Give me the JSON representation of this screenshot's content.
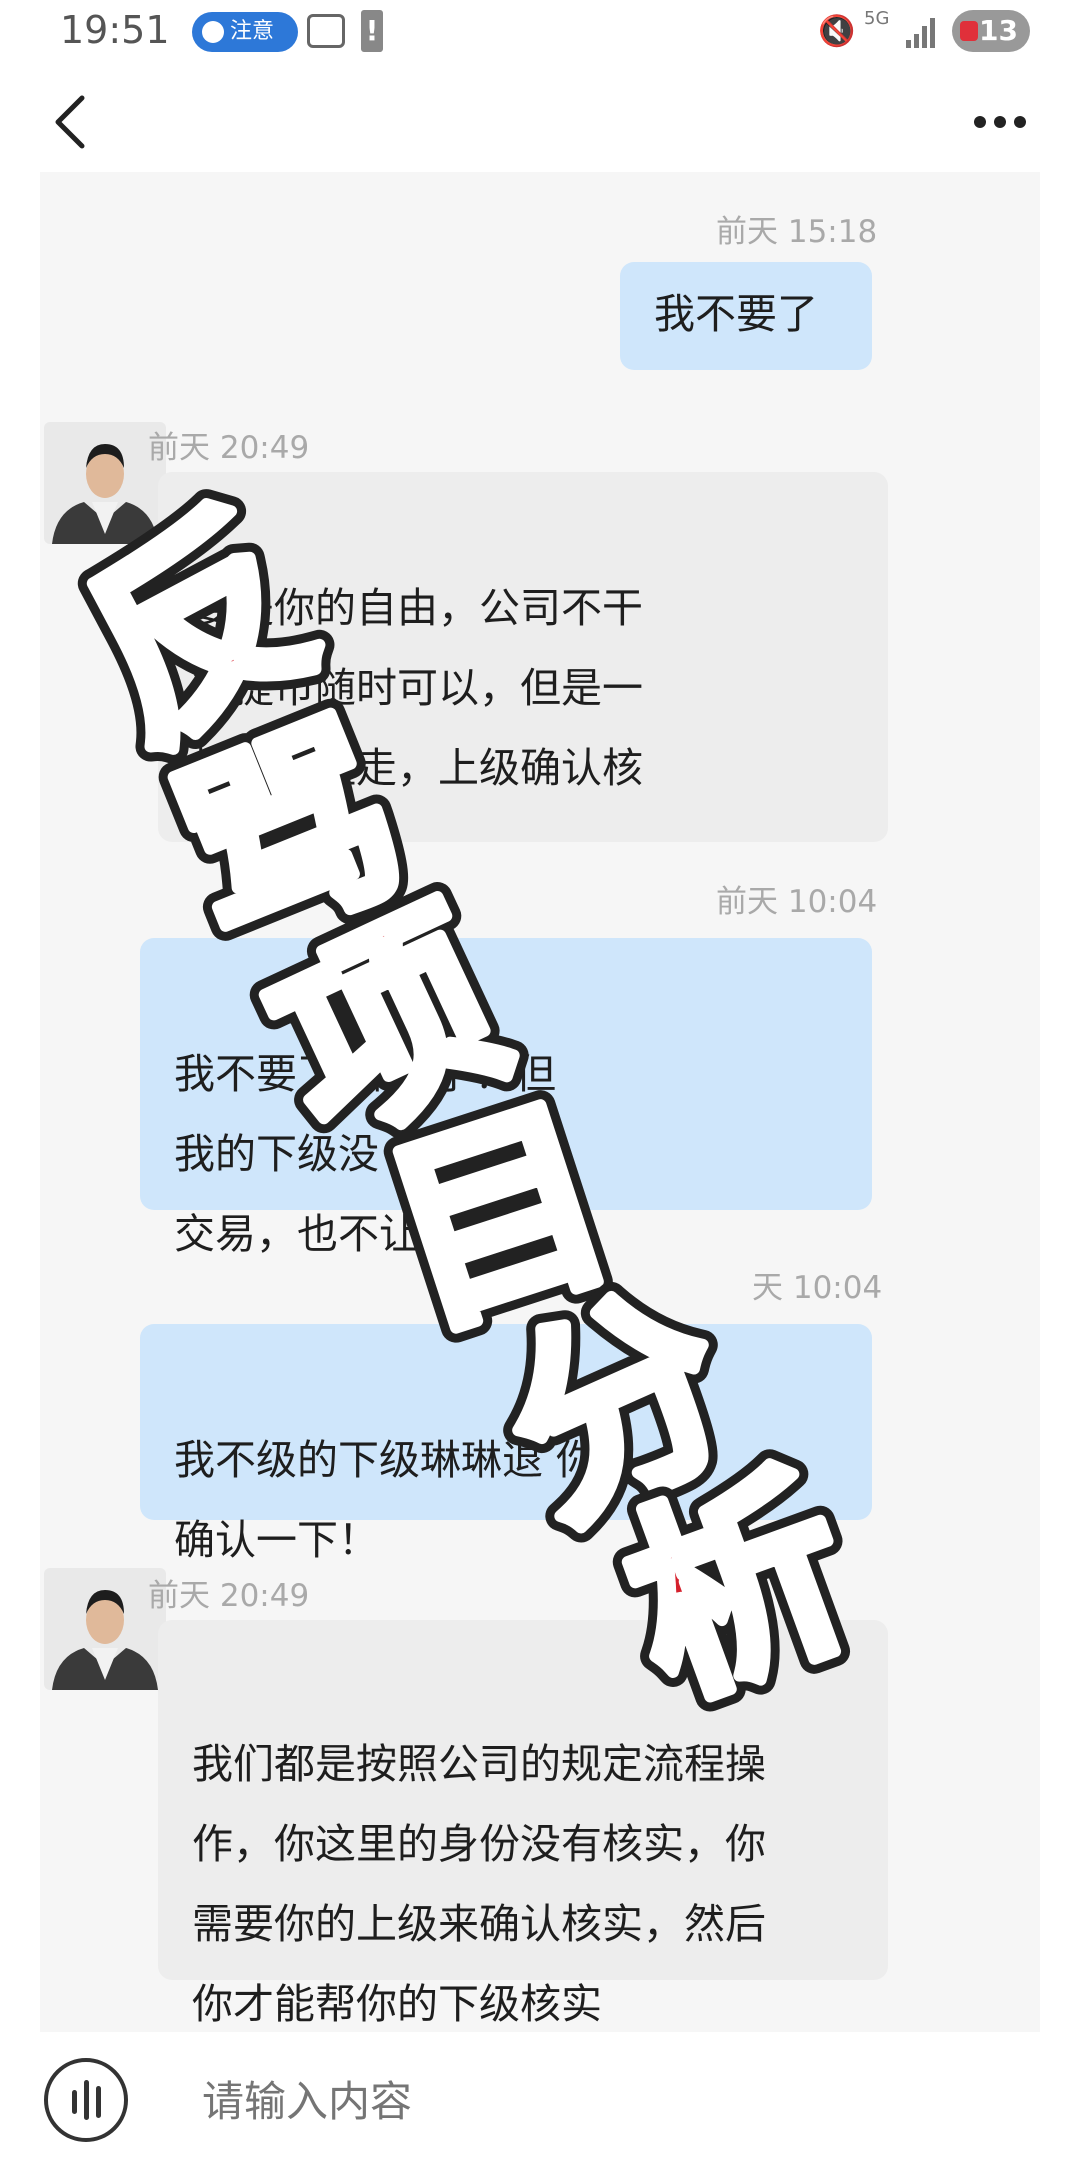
{
  "status_bar": {
    "time": "19:51",
    "pill_label": "注意",
    "network": "5G",
    "battery": "13"
  },
  "icons": {
    "back": "back-icon",
    "more": "more-icon",
    "voice": "voice-icon",
    "mute": "mute-icon",
    "camera": "screenshot-icon",
    "warning": "warning-icon",
    "signal": "signal-icon",
    "battery": "battery-icon"
  },
  "chat": {
    "messages": [
      {
        "side": "out",
        "time": "前天 15:18",
        "text": "我不要了"
      },
      {
        "side": "in",
        "time": "前天 20:49",
        "text": "要是你的自由，公司不干\n想提币随时可以，但是一\n按定流程走，上级确认核"
      },
      {
        "side": "out",
        "time": "前天 10:04",
        "text": "我不要了   操作了！但\n我的下级没   别人正常\n交易，也不让"
      },
      {
        "side": "out",
        "time": "天 10:04",
        "text": "我不级的下级琳琳退        你\n确认一下！"
      },
      {
        "side": "in",
        "time": "前天 20:49",
        "text": "我们都是按照公司的规定流程操\n作，你这里的身份没有核实，你\n需要你的上级来确认核实，然后\n你才能帮你的下级核实"
      }
    ]
  },
  "overlay": {
    "stamp_text": "反骂项目分析",
    "stamp_color": "#d5202c"
  },
  "input": {
    "placeholder": "请输入内容"
  },
  "colors": {
    "outgoing_bubble": "#cfe6fb",
    "incoming_bubble": "#ededed",
    "stamp_red": "#d5202c"
  }
}
